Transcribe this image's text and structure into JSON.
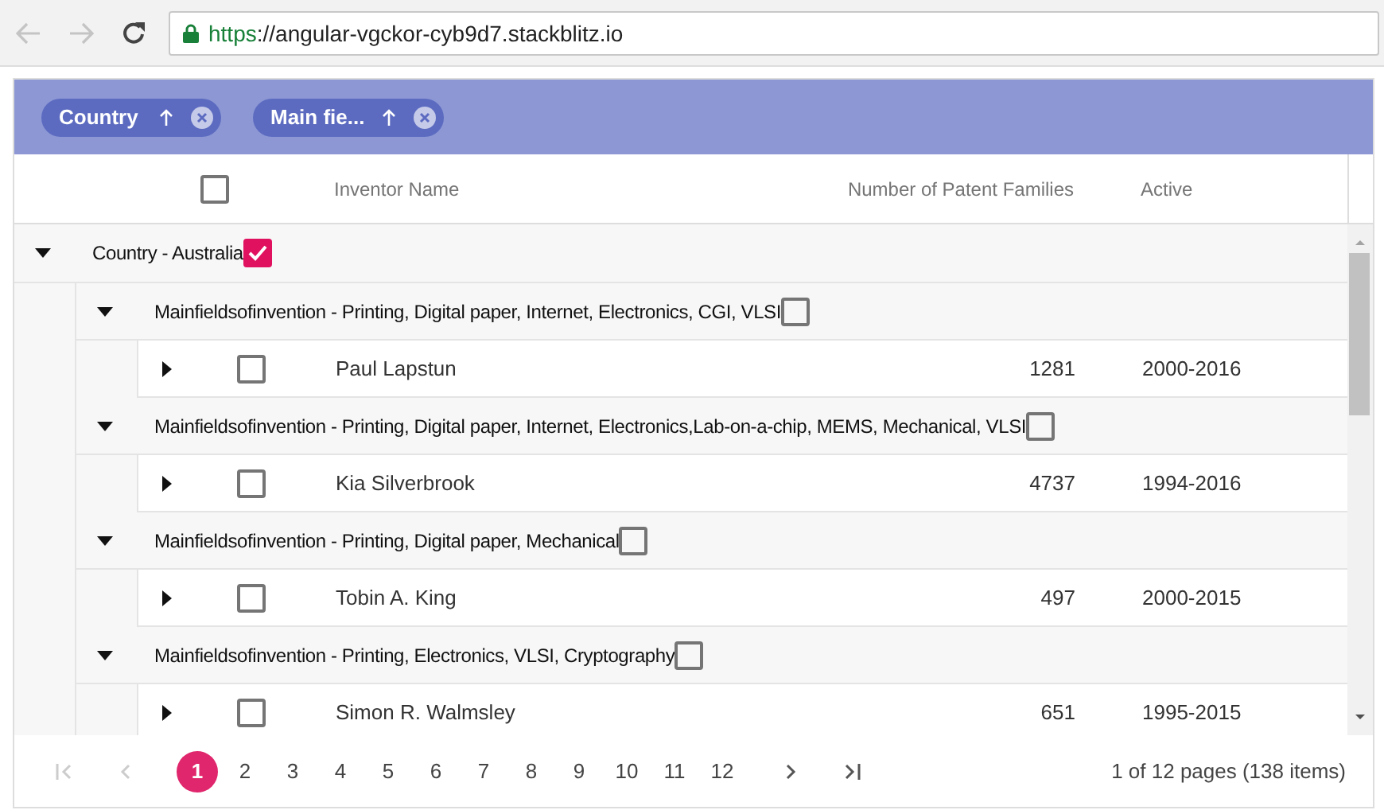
{
  "browser": {
    "back_disabled": true,
    "forward_disabled": true,
    "url_scheme": "https",
    "url_rest": "://angular-vgckor-cyb9d7.stackblitz.io"
  },
  "group_panel": {
    "chips": [
      {
        "label": "Country"
      },
      {
        "label": "Main fie..."
      }
    ]
  },
  "table": {
    "header_checked": false,
    "columns": [
      "Inventor Name",
      "Number of Patent Families",
      "Active"
    ],
    "groups": [
      {
        "label": "Country - Australia",
        "checked": true,
        "expanded": true,
        "children": [
          {
            "label": "Mainfieldsofinvention - Printing, Digital paper, Internet, Electronics, CGI, VLSI",
            "checked": false,
            "expanded": true,
            "rows": [
              {
                "name": "Paul Lapstun",
                "families": "1281",
                "active": "2000-2016",
                "checked": false,
                "expanded": false
              }
            ]
          },
          {
            "label": "Mainfieldsofinvention - Printing, Digital paper, Internet, Electronics,Lab-on-a-chip, MEMS, Mechanical, VLSI",
            "checked": false,
            "expanded": true,
            "rows": [
              {
                "name": "Kia Silverbrook",
                "families": "4737",
                "active": "1994-2016",
                "checked": false,
                "expanded": false
              }
            ]
          },
          {
            "label": "Mainfieldsofinvention - Printing, Digital paper, Mechanical",
            "checked": false,
            "expanded": true,
            "rows": [
              {
                "name": "Tobin A. King",
                "families": "497",
                "active": "2000-2015",
                "checked": false,
                "expanded": false
              }
            ]
          },
          {
            "label": "Mainfieldsofinvention - Printing, Electronics, VLSI, Cryptography",
            "checked": false,
            "expanded": true,
            "rows": [
              {
                "name": "Simon R. Walmsley",
                "families": "651",
                "active": "1995-2015",
                "checked": false,
                "expanded": false
              }
            ]
          }
        ]
      }
    ]
  },
  "pager": {
    "first_disabled": true,
    "prev_disabled": true,
    "pages": [
      {
        "label": "1",
        "selected": true
      },
      {
        "label": "2",
        "selected": false
      },
      {
        "label": "3",
        "selected": false
      },
      {
        "label": "4",
        "selected": false
      },
      {
        "label": "5",
        "selected": false
      },
      {
        "label": "6",
        "selected": false
      },
      {
        "label": "7",
        "selected": false
      },
      {
        "label": "8",
        "selected": false
      },
      {
        "label": "9",
        "selected": false
      },
      {
        "label": "10",
        "selected": false
      },
      {
        "label": "11",
        "selected": false
      },
      {
        "label": "12",
        "selected": false
      }
    ],
    "info": "1 of 12 pages (138 items)"
  }
}
